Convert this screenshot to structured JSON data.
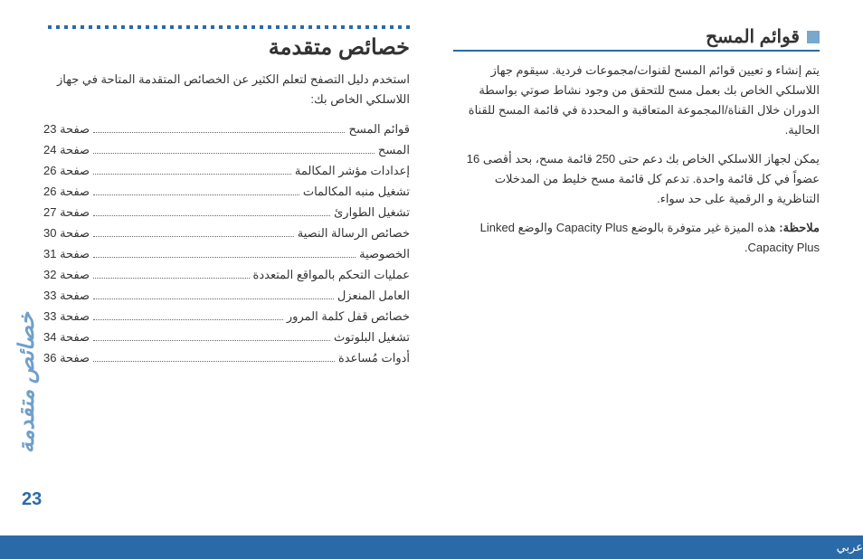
{
  "main_title": "خصائص متقدمة",
  "intro": "استخدم دليل التصفح لتعلم الكثير عن الخصائص المتقدمة المتاحة في جهاز اللاسلكي الخاص بك:",
  "toc": [
    {
      "label": "قوائم المسح",
      "page": "صفحة 23"
    },
    {
      "label": "المسح",
      "page": "صفحة 24"
    },
    {
      "label": "إعدادات مؤشر المكالمة",
      "page": "صفحة 26"
    },
    {
      "label": "تشغيل منبه المكالمات",
      "page": "صفحة 26"
    },
    {
      "label": "تشغيل الطوارئ",
      "page": "صفحة 27"
    },
    {
      "label": "خصائص الرسالة النصية",
      "page": "صفحة 30"
    },
    {
      "label": "الخصوصية",
      "page": "صفحة 31"
    },
    {
      "label": "عمليات التحكم بالمواقع المتعددة",
      "page": "صفحة 32"
    },
    {
      "label": "العامل المنعزل",
      "page": "صفحة 33"
    },
    {
      "label": "خصائص قفل كلمة المرور",
      "page": "صفحة 33"
    },
    {
      "label": "تشغيل البلوتوث",
      "page": "صفحة 34"
    },
    {
      "label": "أدوات مُساعدة",
      "page": "صفحة 36"
    }
  ],
  "section": {
    "title": "قوائم المسح",
    "p1": "يتم إنشاء و تعيين قوائم المسح لقنوات/مجموعات فردية. سيقوم جهاز اللاسلكي الخاص بك بعمل مسح للتحقق من وجود نشاط صوتي بواسطة الدوران خلال القناة/المجموعة المتعاقبة و المحددة في قائمة المسح للقناة الحالية.",
    "p2": "يمكن لجهاز اللاسلكي الخاص بك دعم حتى 250 قائمة مسح، بحد أقصى 16 عضواً في كل قائمة واحدة. تدعم كل قائمة مسح خليط من المدخلات التناظرية و الرقمية على حد سواء.",
    "note_label": "ملاحظة:",
    "note_text": "هذه الميزة غير متوفرة بالوضع Capacity Plus والوضع Linked Capacity Plus."
  },
  "side_title": "خصائص متقدمة",
  "page_number": "23",
  "footer_lang": "عربي"
}
